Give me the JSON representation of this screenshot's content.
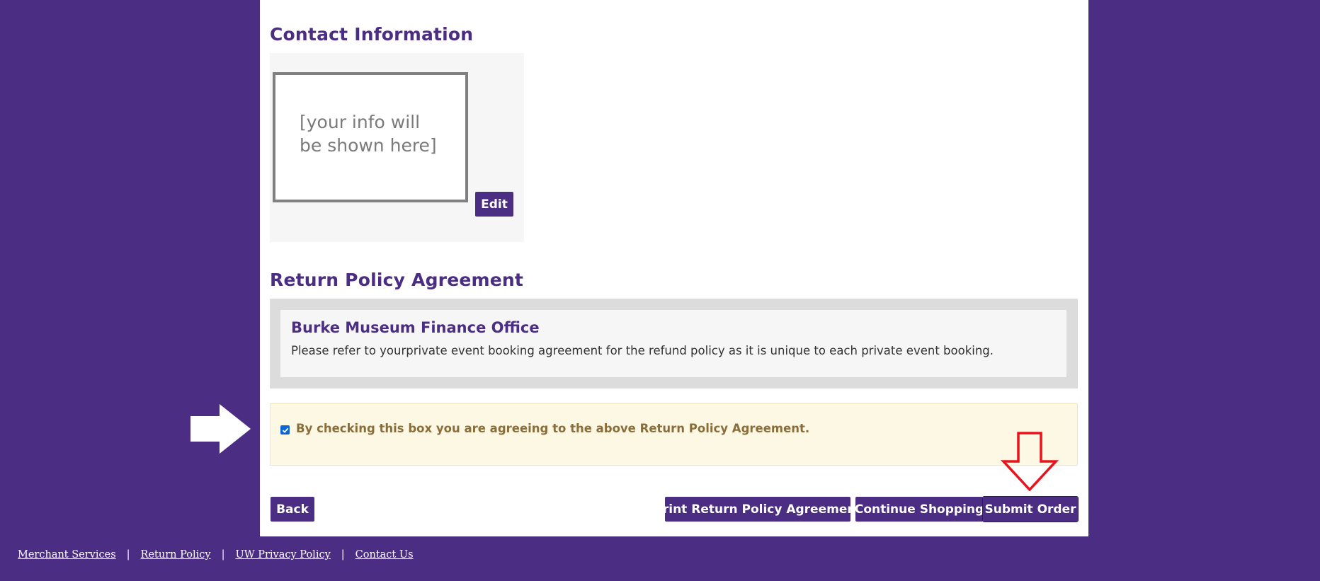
{
  "contact": {
    "heading": "Contact Information",
    "placeholder": "[your info will be shown here]",
    "edit_label": "Edit"
  },
  "return_policy": {
    "heading": "Return Policy Agreement",
    "office": "Burke Museum Finance Office",
    "text": "Please refer to yourprivate event booking agreement for the refund policy as it is unique to each private event booking.",
    "agree_label": "By checking this box you are agreeing to the above Return Policy Agreement.",
    "agree_checked": true
  },
  "actions": {
    "back": "Back",
    "print": "Print Return Policy Agreement",
    "continue": "Continue Shopping",
    "submit": "Submit Order"
  },
  "footer": {
    "links": [
      "Merchant Services",
      "Return Policy",
      "UW Privacy Policy",
      "Contact Us"
    ],
    "separator": "|"
  },
  "icons": {
    "pointer_arrow": "arrow-right-icon",
    "submit_arrow": "arrow-down-icon"
  },
  "colors": {
    "brand": "#4b2e83",
    "arrow_outline": "#e8131c"
  }
}
